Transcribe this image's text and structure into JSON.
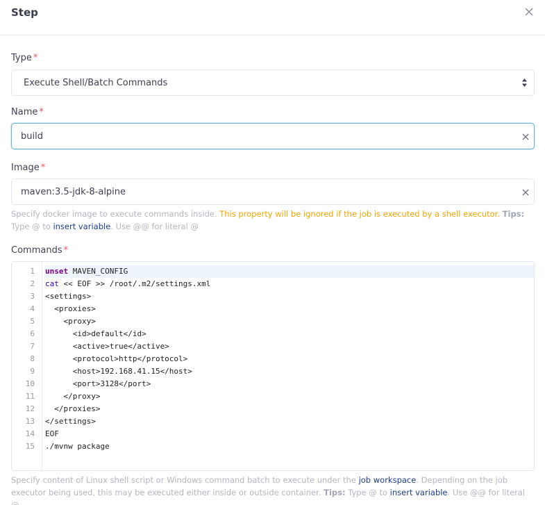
{
  "header": {
    "title": "Step",
    "close_icon": "close-icon"
  },
  "type_field": {
    "label": "Type",
    "required_mark": "*",
    "value": "Execute Shell/Batch Commands"
  },
  "name_field": {
    "label": "Name",
    "required_mark": "*",
    "value": "build"
  },
  "image_field": {
    "label": "Image",
    "required_mark": "*",
    "value": "maven:3.5-jdk-8-alpine",
    "help_text": "Specify docker image to execute commands inside.",
    "help_warning": "This property will be ignored if the job is executed by a shell executor.",
    "help_tips_label": "Tips:",
    "help_tips_prefix": "Type @ to",
    "help_tips_link": "insert variable",
    "help_tips_suffix": ". Use @@ for literal @"
  },
  "commands_field": {
    "label": "Commands",
    "required_mark": "*",
    "line_numbers": [
      "1",
      "2",
      "3",
      "4",
      "5",
      "6",
      "7",
      "8",
      "9",
      "10",
      "11",
      "12",
      "13",
      "14",
      "15"
    ],
    "lines": [
      {
        "kw": "unset",
        "rest": " MAVEN_CONFIG"
      },
      {
        "kw": "cat",
        "rest": " << EOF >> /root/.m2/settings.xml"
      },
      {
        "kw": "",
        "rest": "<settings>"
      },
      {
        "kw": "",
        "rest": "  <proxies>"
      },
      {
        "kw": "",
        "rest": "    <proxy>"
      },
      {
        "kw": "",
        "rest": "      <id>default</id>"
      },
      {
        "kw": "",
        "rest": "      <active>true</active>"
      },
      {
        "kw": "",
        "rest": "      <protocol>http</protocol>"
      },
      {
        "kw": "",
        "rest": "      <host>192.168.41.15</host>"
      },
      {
        "kw": "",
        "rest": "      <port>3128</port>"
      },
      {
        "kw": "",
        "rest": "    </proxy>"
      },
      {
        "kw": "",
        "rest": "  </proxies>"
      },
      {
        "kw": "",
        "rest": "</settings>"
      },
      {
        "kw": "",
        "rest": "EOF"
      },
      {
        "kw": "",
        "rest": "./mvnw package"
      }
    ],
    "help_prefix": "Specify content of Linux shell script or Windows command batch to execute under the",
    "help_link1": "job workspace",
    "help_middle": ". Depending on the job executor being used, this may be executed either inside or outside container.",
    "help_tips_label": "Tips:",
    "help_tips_prefix": "Type @ to",
    "help_tips_link": "insert variable",
    "help_tips_suffix": ". Use @@ for literal @"
  },
  "colors": {
    "required": "#f64e60",
    "warning": "#f0a500",
    "link": "#1b3c8f",
    "focus": "#69b3cf"
  }
}
